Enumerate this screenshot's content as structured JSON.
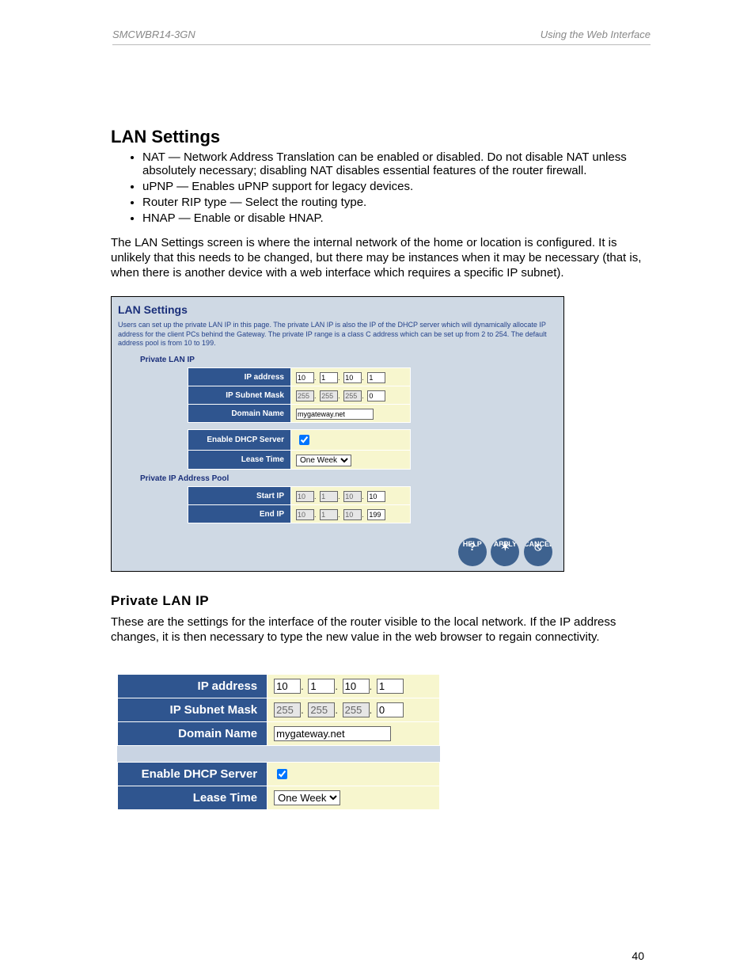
{
  "header": {
    "left": "SMCWBR14-3GN",
    "right": "Using the Web Interface"
  },
  "doc": {
    "section_title": "LAN Settings",
    "bullets": [
      "NAT — Network Address Translation can be enabled or disabled. Do not disable NAT unless absolutely necessary; disabling NAT disables essential features of the router firewall.",
      "uPNP — Enables uPNP support for legacy devices.",
      "Router RIP type — Select the routing type.",
      "HNAP — Enable or disable HNAP."
    ],
    "intro_para": "The LAN Settings screen is where the internal network of the home or location is configured. It is unlikely that this needs to be changed, but there may be instances when it may be necessary (that is, when there is another device with a web interface which requires a specific IP subnet).",
    "private_lan_heading": "Private LAN IP",
    "private_lan_para": "These are the settings for the interface of the router visible to the local network. If the IP address changes, it is then necessary to type the new value in the web browser to regain connectivity."
  },
  "panel": {
    "title": "LAN Settings",
    "description": "Users can set up the private LAN IP in this page. The private LAN IP is also the IP of the DHCP server which will dynamically allocate IP address for the client PCs behind the Gateway. The private IP range is a class C address which can be set up from 2 to 254. The default address pool is from 10 to 199.",
    "section_private_lan": "Private LAN IP",
    "section_pool": "Private IP Address Pool",
    "labels": {
      "ip_address": "IP address",
      "subnet": "IP Subnet Mask",
      "domain": "Domain Name",
      "enable_dhcp": "Enable DHCP Server",
      "lease_time": "Lease Time",
      "start_ip": "Start IP",
      "end_ip": "End IP"
    },
    "values": {
      "ip": [
        "10",
        "1",
        "10",
        "1"
      ],
      "subnet": [
        "255",
        "255",
        "255",
        "0"
      ],
      "domain": "mygateway.net",
      "dhcp_enabled": true,
      "lease_time": "One Week",
      "start_ip": [
        "10",
        "1",
        "10",
        "10"
      ],
      "end_ip": [
        "10",
        "1",
        "10",
        "199"
      ]
    },
    "buttons": {
      "help": "HELP",
      "apply": "APPLY",
      "cancel": "CANCEL"
    }
  },
  "page_number": "40"
}
